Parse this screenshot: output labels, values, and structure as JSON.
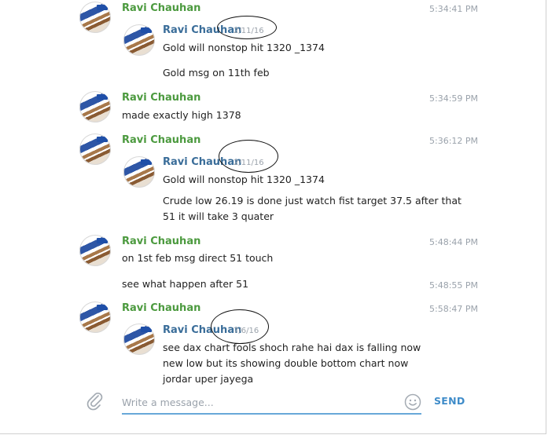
{
  "messages": [
    {
      "sender": "Ravi Chauhan",
      "time": "5:34:41 PM",
      "forward": {
        "sender": "Ravi Chauhan",
        "date": "2/11/16",
        "lines": [
          "Gold will nonstop hit 1320 _1374",
          "Gold msg on 11th feb"
        ]
      }
    },
    {
      "sender": "Ravi Chauhan",
      "time": "5:34:59 PM",
      "text": "made exactly high 1378"
    },
    {
      "sender": "Ravi Chauhan",
      "time": "5:36:12 PM",
      "forward": {
        "sender": "Ravi Chauhan",
        "date": "2/11/16",
        "lines": [
          "Gold will nonstop hit 1320 _1374",
          "Crude low 26.19 is done just watch fist target 37.5 after that 51 it will take 3 quater"
        ]
      }
    },
    {
      "sender": "Ravi Chauhan",
      "time": "5:48:44 PM",
      "text": "on 1st feb msg direct 51 touch",
      "followup": {
        "text": "see what happen after 51",
        "time": "5:48:55 PM"
      }
    },
    {
      "sender": "Ravi Chauhan",
      "time": "5:58:47 PM",
      "forward": {
        "sender": "Ravi Chauhan",
        "date": "7/6/16",
        "lines": [
          "see dax chart fools shoch rahe hai dax is falling now new low but its showing double bottom chart now jordar uper jayega"
        ]
      }
    }
  ],
  "composer": {
    "placeholder": "Write a message...",
    "value": "",
    "send_label": "SEND",
    "attach_icon": "paperclip-icon",
    "emoji_icon": "smiley-icon"
  },
  "colors": {
    "sender": "#4c9a3f",
    "forward_sender": "#3a6d99",
    "meta": "#9aa2ab",
    "accent": "#3f8cc9"
  }
}
